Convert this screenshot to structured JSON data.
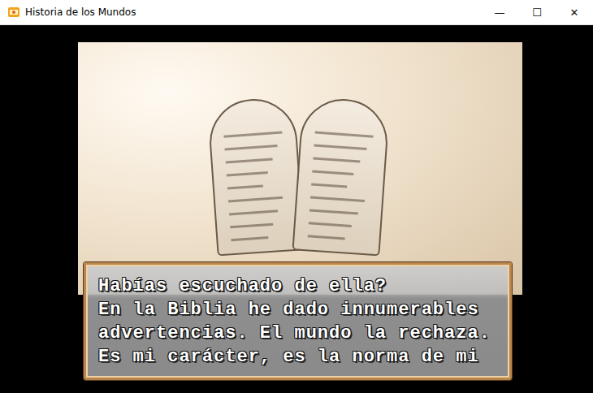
{
  "window": {
    "title": "Historia de los Mundos",
    "controls": [
      "—",
      "☐",
      "✕"
    ]
  },
  "dialog": {
    "lines": [
      "Habías escuchado de ella?",
      "En la Biblia he dado innumerables",
      "advertencias. El mundo la rechaza.",
      "Es mi carácter, es la norma de mi"
    ]
  }
}
